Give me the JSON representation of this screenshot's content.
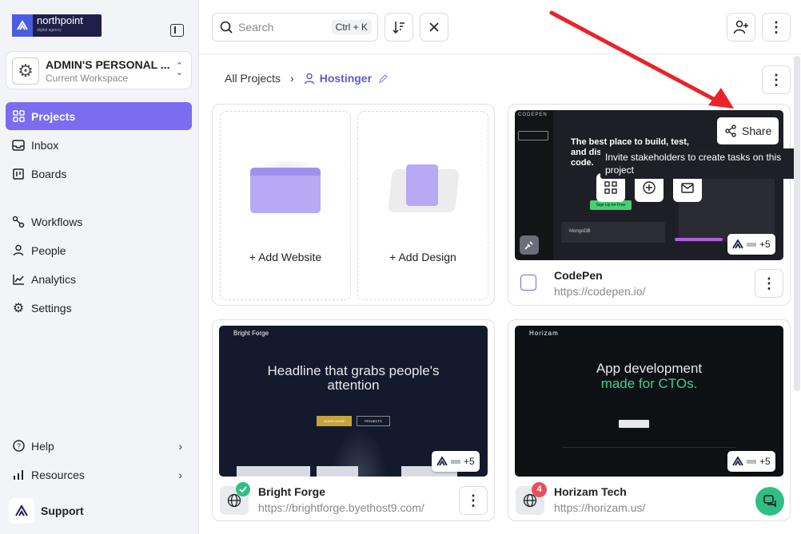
{
  "brand": {
    "logo_text": "northpoint",
    "logo_sub": "digital agency"
  },
  "workspace": {
    "name": "ADMIN'S PERSONAL ...",
    "subtitle": "Current Workspace"
  },
  "nav": {
    "projects": "Projects",
    "inbox": "Inbox",
    "boards": "Boards",
    "workflows": "Workflows",
    "people": "People",
    "analytics": "Analytics",
    "settings": "Settings",
    "help": "Help",
    "resources": "Resources",
    "support": "Support"
  },
  "search": {
    "placeholder": "Search",
    "shortcut": "Ctrl + K"
  },
  "breadcrumb": {
    "root": "All Projects",
    "current": "Hostinger"
  },
  "add_cards": {
    "website": "+ Add Website",
    "design": "+ Add Design"
  },
  "projects": [
    {
      "name": "CodePen",
      "url": "https://codepen.io/",
      "badge": "+5"
    },
    {
      "name": "Bright Forge",
      "url": "https://brightforge.byethost9.com/",
      "badge": "+5"
    },
    {
      "name": "Horizam Tech",
      "url": "https://horizam.us/",
      "badge": "+5",
      "notifications": "4"
    }
  ],
  "share": {
    "label": "Share",
    "tooltip": "Invite stakeholders to create tasks on this project"
  },
  "thumb_text": {
    "codepen_logo": "CODEPEN",
    "codepen_head": "The best place to build, test, and discover front-end code.",
    "codepen_btn": "Sign Up for Free",
    "codepen_mongo": "MongoDB",
    "bf_brand": "Bright Forge",
    "bf_head": "Headline that grabs people's attention",
    "bf_btn1": "LEARN MORE",
    "bf_btn2": "PROJECTS",
    "hz_brand": "Horizam",
    "hz_head1": "App development",
    "hz_head2": "made for CTOs."
  },
  "colors": {
    "accent": "#7b6cf0",
    "link": "#5b5bd6",
    "arrow": "#e8242a",
    "chat": "#2fbf83"
  }
}
